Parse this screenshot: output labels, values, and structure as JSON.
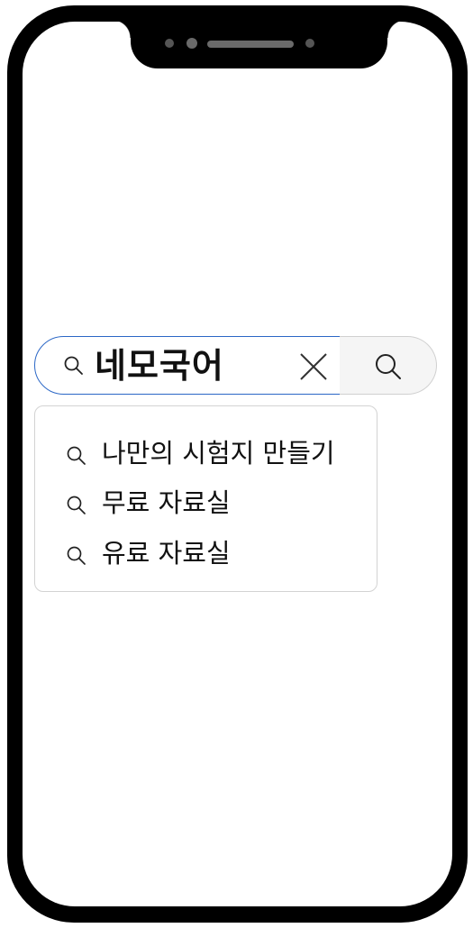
{
  "search": {
    "query": "네모국어",
    "lead_icon": "search-icon",
    "clear_icon": "close-icon",
    "submit_icon": "search-icon",
    "accent_color": "#2b67c6"
  },
  "suggestions": [
    {
      "icon": "search-icon",
      "label": "나만의 시험지 만들기"
    },
    {
      "icon": "search-icon",
      "label": "무료 자료실"
    },
    {
      "icon": "search-icon",
      "label": "유료 자료실"
    }
  ]
}
